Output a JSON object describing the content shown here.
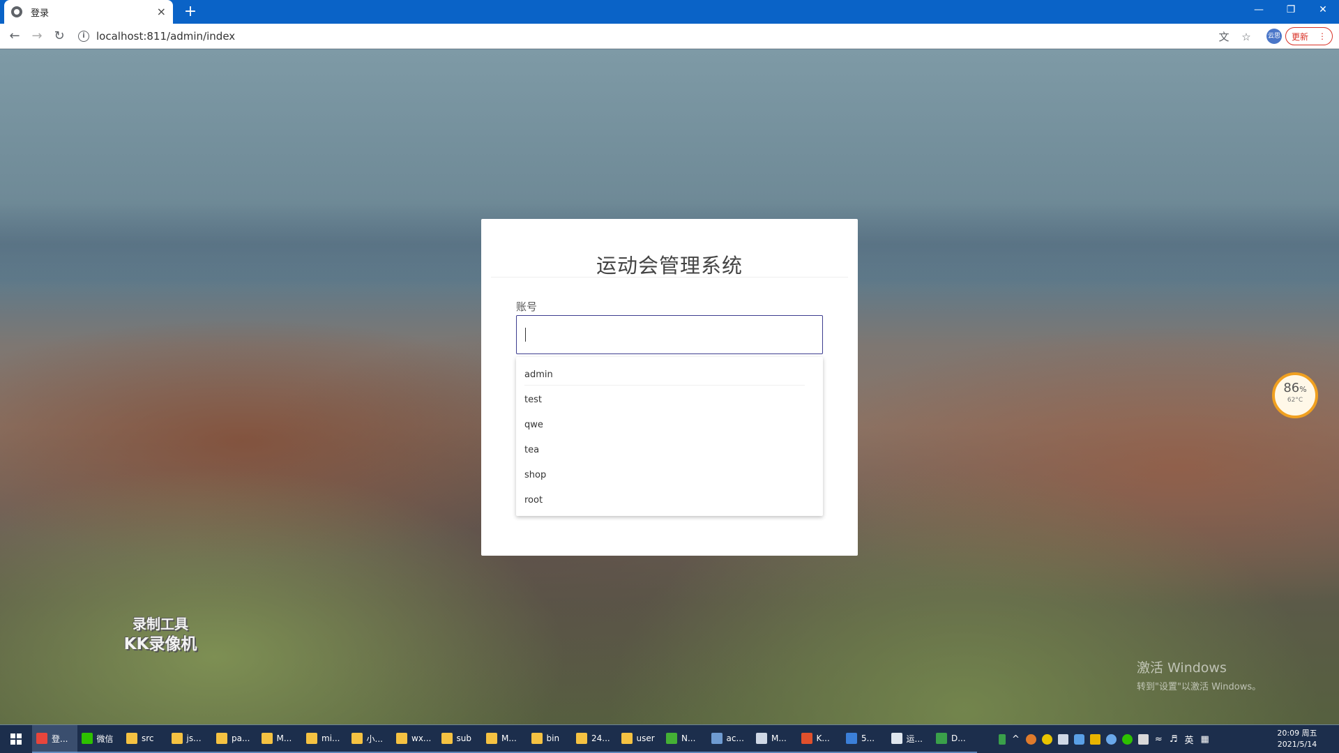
{
  "browser": {
    "tab_title": "登录",
    "tab_close": "×",
    "new_tab": "+",
    "url": "localhost:811/admin/index",
    "profile_label": "云思",
    "update_label": "更新",
    "update_menu": "⋮"
  },
  "page": {
    "title": "运动会管理系统",
    "account_label": "账号",
    "account_value": "",
    "autocomplete_options": [
      "admin",
      "test",
      "qwe",
      "tea",
      "shop",
      "root"
    ]
  },
  "overlay": {
    "temp_percent": "86",
    "temp_percent_sign": "%",
    "temp_celsius": "62°C",
    "kk_line1": "录制工具",
    "kk_line2": "KK录像机",
    "activate_title": "激活 Windows",
    "activate_hint": "转到\"设置\"以激活 Windows。"
  },
  "taskbar": {
    "items": [
      {
        "label": "登...",
        "color": "#e8453c"
      },
      {
        "label": "微信",
        "color": "#2dc100"
      },
      {
        "label": "src",
        "color": "#f5c242"
      },
      {
        "label": "js...",
        "color": "#f5c242"
      },
      {
        "label": "pa...",
        "color": "#f5c242"
      },
      {
        "label": "M...",
        "color": "#f5c242"
      },
      {
        "label": "mi...",
        "color": "#f5c242"
      },
      {
        "label": "小...",
        "color": "#f5c242"
      },
      {
        "label": "wx...",
        "color": "#f5c242"
      },
      {
        "label": "sub",
        "color": "#f5c242"
      },
      {
        "label": "M...",
        "color": "#f5c242"
      },
      {
        "label": "bin",
        "color": "#f5c242"
      },
      {
        "label": "24...",
        "color": "#f5c242"
      },
      {
        "label": "user",
        "color": "#f5c242"
      },
      {
        "label": "N...",
        "color": "#44b035"
      },
      {
        "label": "ac...",
        "color": "#6f9bd1"
      },
      {
        "label": "M...",
        "color": "#cfd8e6"
      },
      {
        "label": "K...",
        "color": "#e0502c"
      },
      {
        "label": "5...",
        "color": "#3b7fd8"
      },
      {
        "label": "运...",
        "color": "#dfe6ee"
      },
      {
        "label": "D...",
        "color": "#3aa04a"
      }
    ],
    "ime": "英",
    "clock_time": "20:09 周五",
    "clock_date": "2021/5/14"
  }
}
